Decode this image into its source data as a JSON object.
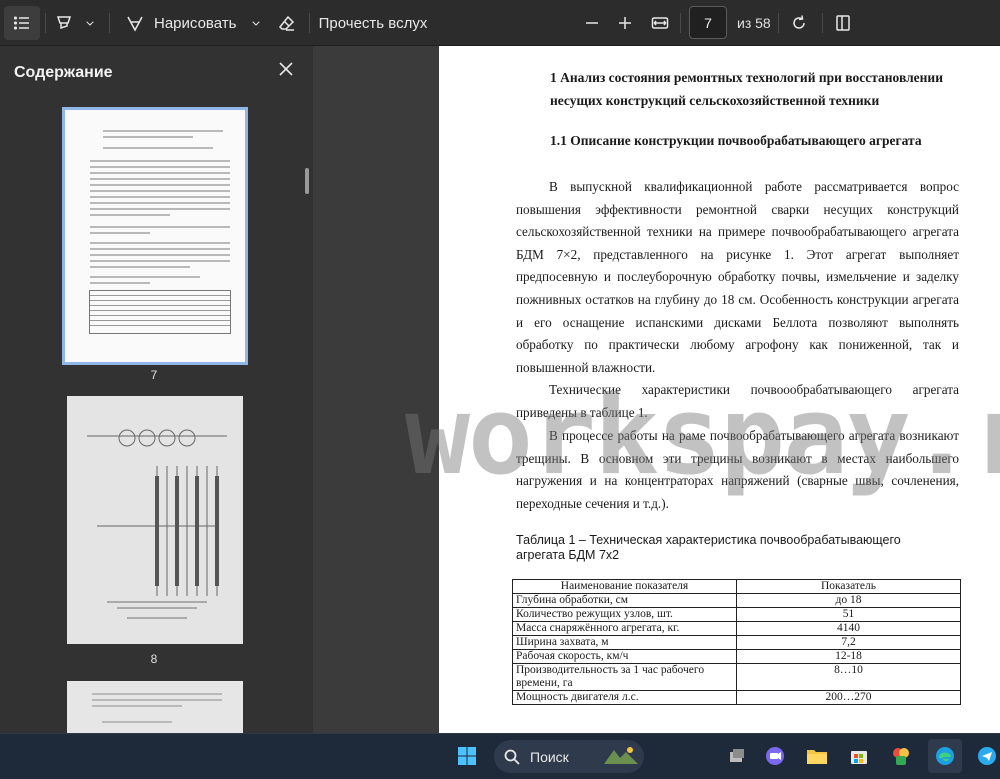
{
  "toolbar": {
    "draw_label": "Нарисовать",
    "read_aloud_label": "Прочесть вслух",
    "current_page": "7",
    "page_of": "из 58"
  },
  "sidebar": {
    "title": "Содержание",
    "thumbnails": [
      {
        "page": "7"
      },
      {
        "page": "8"
      }
    ]
  },
  "document": {
    "heading1": "1 Анализ состояния ремонтных технологий при восстановлении несущих конструкций сельскохозяйственной техники",
    "heading2": "1.1 Описание конструкции почвообрабатывающего агрегата",
    "para1": "В выпускной квалификационной работе рассматривается вопрос повышения эффективности ремонтной сварки несущих конструкций сельскохозяйственной техники на примере почвообрабатывающего агрегата БДМ 7×2, представленного на рисунке 1. Этот агрегат выполняет предпосевную и послеуборочную обработку почвы, измельчение и заделку пожнивных остатков на глубину до 18 см. Особенность конструкции агрегата и его оснащение испанскими дисками Беллота позволяют выполнять обработку по практически любому агрофону как пониженной, так и повышенной влажности.",
    "para2": "Технические характеристики почвоообрабатывающего агрегата приведены в таблице 1.",
    "para3": "В процессе работы на раме почвообрабатывающего агрегата возникают трещины. В основном эти трещины возникают в местах наибольшего нагружения и на концентраторах напряжений (сварные швы, сочленения, переходные сечения и т.д.).",
    "table_caption": "Таблица 1 – Техническая характеристика почвообрабатывающего агрегата БДМ 7х2",
    "table": {
      "headers": [
        "Наименование показателя",
        "Показатель"
      ],
      "rows": [
        [
          "Глубина обработки, см",
          "до 18"
        ],
        [
          "Количество режущих узлов, шт.",
          "51"
        ],
        [
          "Масса снаряжённого агрегата, кг.",
          "4140"
        ],
        [
          "Ширина захвата, м",
          "7,2"
        ],
        [
          "Рабочая скорость, км/ч",
          "12-18"
        ],
        [
          "Производительность за 1 час рабочего времени, га",
          "8…10"
        ],
        [
          "Мощность двигателя  л.с.",
          "200…270"
        ]
      ]
    }
  },
  "watermark": "workspay.ru",
  "taskbar": {
    "search_label": "Поиск"
  }
}
